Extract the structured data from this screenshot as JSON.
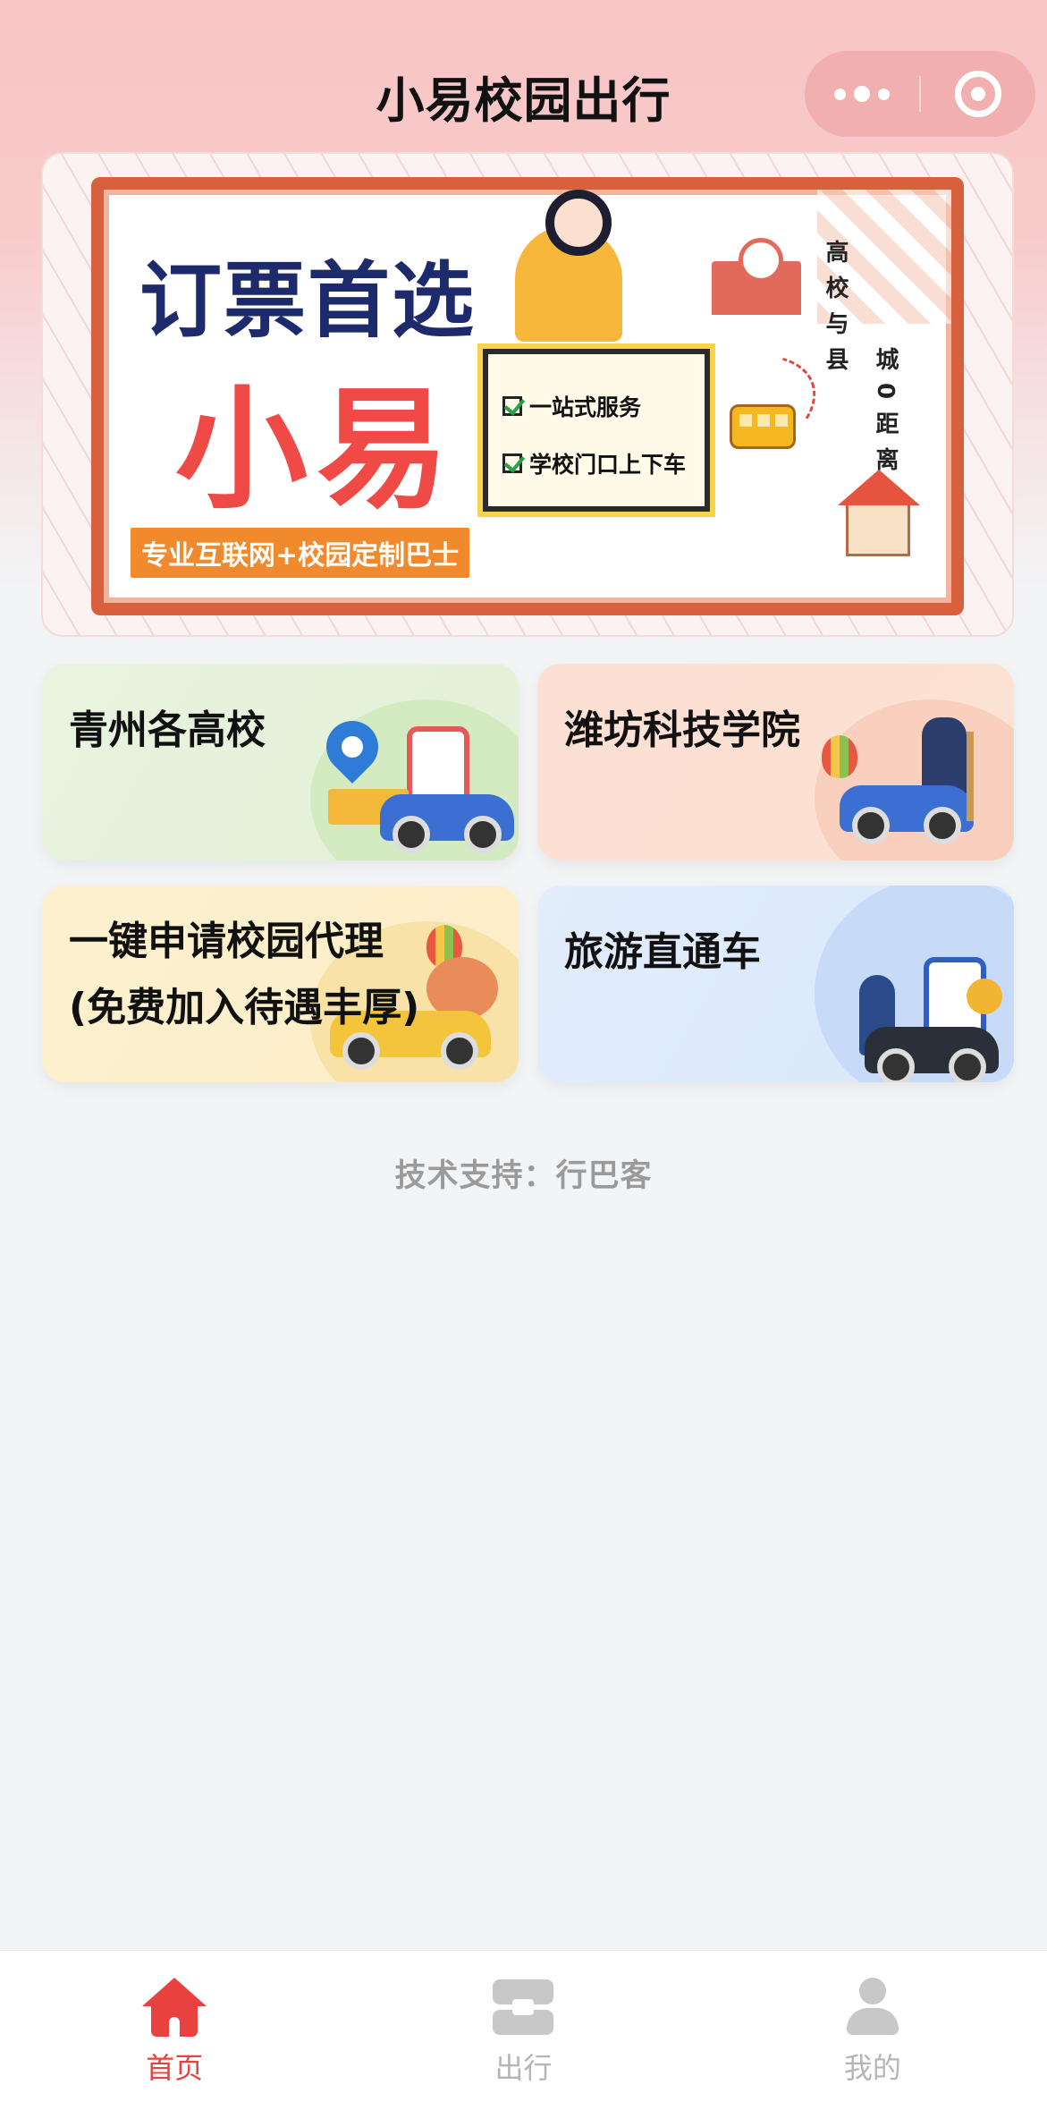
{
  "nav": {
    "title": "小易校园出行"
  },
  "banner": {
    "headline": "订票首选",
    "brand": "小易",
    "tagline": "专业互联网+校园定制巴士",
    "features": [
      "一站式服务",
      "学校门口上下车"
    ],
    "vertical_text_1": "高校与县",
    "vertical_text_2": "城0距离"
  },
  "cards": [
    {
      "title": "青州各高校"
    },
    {
      "title": "潍坊科技学院"
    },
    {
      "title_line1": "一键申请校园代理",
      "title_line2": "(免费加入待遇丰厚)"
    },
    {
      "title": "旅游直通车"
    }
  ],
  "footer": {
    "support": "技术支持：行巴客"
  },
  "tabbar": {
    "items": [
      {
        "label": "首页",
        "icon": "home-icon",
        "active": true
      },
      {
        "label": "出行",
        "icon": "trip-icon",
        "active": false
      },
      {
        "label": "我的",
        "icon": "user-icon",
        "active": false
      }
    ],
    "active_color": "#e9413f",
    "inactive_color": "#b5b5b5"
  }
}
